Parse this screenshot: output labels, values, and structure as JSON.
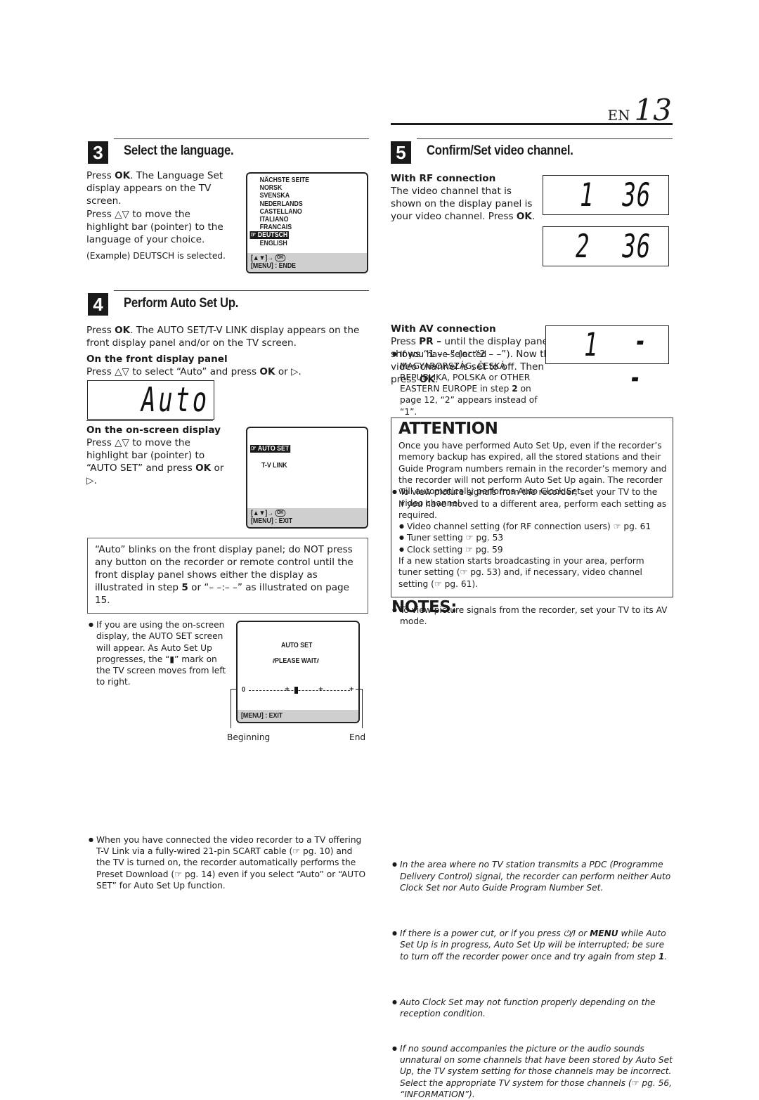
{
  "header": {
    "lang": "EN",
    "page": "13"
  },
  "step3": {
    "num": "3",
    "title": "Select the language.",
    "p1_pre": "Press ",
    "p1_bold": "OK",
    "p1_post": ". The Language Set display appears on the TV screen.",
    "p2": "Press △▽ to move the highlight bar (pointer) to the language of your choice.",
    "example": "(Example) DEUTSCH is selected.",
    "osd": {
      "items": [
        "NÄCHSTE SEITE",
        "NORSK",
        "SVENSKA",
        "NEDERLANDS",
        "CASTELLANO",
        "ITALIANO",
        "FRANCAIS",
        "DEUTSCH",
        "ENGLISH"
      ],
      "selected": "DEUTSCH",
      "nav": "[▲▼]→",
      "ok": "OK",
      "footer": "[MENU] : ENDE"
    }
  },
  "step4": {
    "num": "4",
    "title": "Perform Auto Set Up.",
    "p1_pre": "Press ",
    "p1_bold": "OK",
    "p1_post": ". The AUTO SET/T-V LINK display appears on the front display panel and/or on the TV screen.",
    "front_heading": "On the front display panel",
    "front_pre": "Press △▽ to select “Auto” and press ",
    "front_bold": "OK",
    "front_post": " or ▷.",
    "lcd_text": "Auto",
    "onscreen_heading": "On the on-screen display",
    "onscreen_pre": "Press △▽ to move the highlight bar (pointer) to “AUTO SET” and press ",
    "onscreen_bold": "OK",
    "onscreen_post": " or ▷.",
    "osd": {
      "item1": "AUTO SET",
      "item2": "T-V LINK",
      "nav": "[▲▼]→",
      "ok": "OK",
      "footer": "[MENU] : EXIT"
    },
    "warning_pre": "“Auto” blinks on the front display panel; do NOT press any button on the recorder or remote control until the front display panel shows either the display as illustrated in step ",
    "warning_bold": "5",
    "warning_post": " or “– –:– –” as illustrated on page 15.",
    "bullet1": "If you are using the on-screen display, the AUTO SET screen will appear. As Auto Set Up progresses, the “▮” mark on the TV screen moves from left to right.",
    "progress_osd": {
      "title": "AUTO SET",
      "status": "PLEASE WAIT",
      "scale": "0-----+----▮----+-----+",
      "progress": 0.45,
      "footer": "[MENU] : EXIT",
      "label_begin": "Beginning",
      "label_end": "End"
    },
    "bullet2": "When you have connected the video recorder to a TV offering T-V Link via a fully-wired 21-pin SCART cable (☞ pg. 10) and the TV is turned on, the recorder automatically performs the Preset Download (☞ pg. 14) even if you select “Auto” or “AUTO SET” for Auto Set Up function."
  },
  "step5": {
    "num": "5",
    "title": "Confirm/Set video channel.",
    "rf_heading": "With RF connection",
    "rf_pre": "The video channel that is shown on the display panel is your video channel. Press ",
    "rf_bold": "OK",
    "rf_post": ".",
    "rf_bullet1_pre": "If you have selected MAGYARORSZÁG, ČESKÁ REPUBLIKA, POLSKA or OTHER EASTERN EUROPE in step ",
    "rf_bullet1_bold": "2",
    "rf_bullet1_post": " on page 12, “2” appears instead of “1”.",
    "rf_bullet2": "To view picture signals from the recorder, set your TV to the video channel.",
    "lcd1": {
      "left": "1",
      "right": "36"
    },
    "lcd2": {
      "left": "2",
      "right": "36"
    },
    "av_heading": "With AV connection",
    "av_pre": "Press ",
    "av_bold": "PR –",
    "av_mid": " until the display panel shows “1 – –” (or “2 – –”). Now the video channel is set to off. Then press ",
    "av_bold2": "OK",
    "av_post": ".",
    "av_bullet": "To view picture signals from the recorder, set your TV to its AV mode.",
    "lcd3": {
      "left": "1",
      "right": "- -"
    }
  },
  "attention": {
    "title": "ATTENTION",
    "p1": "Once you have performed Auto Set Up, even if the recorder’s memory backup has expired, all the stored stations and their Guide Program numbers remain in the recorder’s memory and the recorder will not perform Auto Set Up again. The recorder will automatically performs Auto Clock Set.",
    "p2": "If you have moved to a different area, perform each setting as required.",
    "bullets": [
      "Video channel setting (for RF connection users) ☞ pg. 61",
      "Tuner setting ☞ pg. 53",
      "Clock setting ☞ pg. 59"
    ],
    "p3": "If a new station starts broadcasting in your area, perform tuner setting (☞ pg. 53) and, if necessary, video channel setting (☞ pg. 61)."
  },
  "notes": {
    "title": "NOTES:",
    "n1": "In the area where no TV station transmits a PDC (Programme Delivery Control) signal, the recorder can perform neither Auto Clock Set nor Auto Guide Program Number Set.",
    "n2_pre": "If there is a power cut, or if you press ⏻/I or ",
    "n2_bold": "MENU",
    "n2_mid": " while Auto Set Up is in progress, Auto Set Up will be interrupted; be sure to turn off the recorder power once and try again from step ",
    "n2_bold2": "1",
    "n2_post": ".",
    "n3": "Auto Clock Set may not function properly depending on the reception condition.",
    "n4": "If no sound accompanies the picture or the audio sounds unnatural on some channels that have been stored by Auto Set Up, the TV system setting for those channels may be incorrect. Select the appropriate TV system for those channels (☞ pg. 56, “INFORMATION”)."
  }
}
